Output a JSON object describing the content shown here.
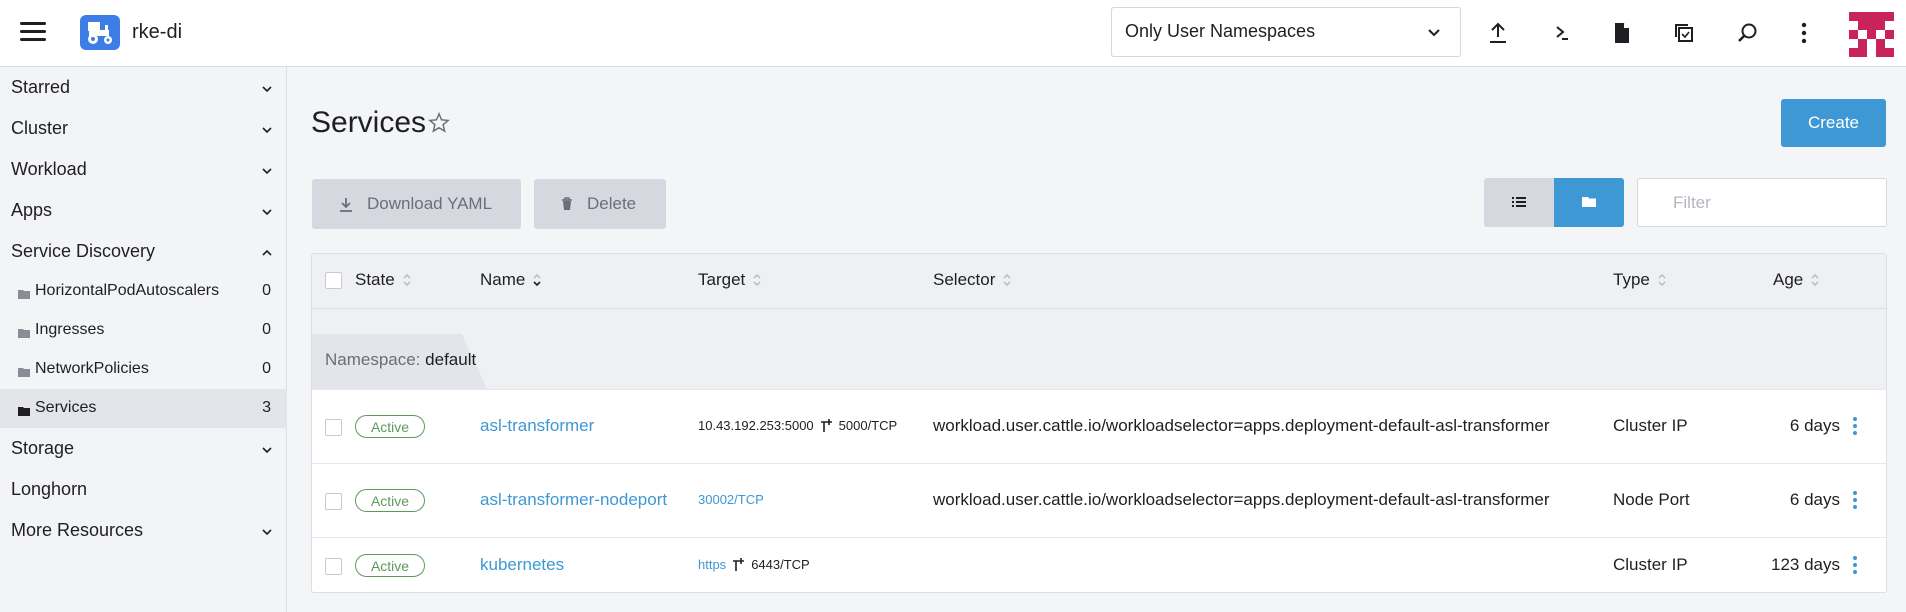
{
  "header": {
    "cluster_name": "rke-di",
    "namespace_filter": "Only User Namespaces",
    "actions": [
      "upload-icon",
      "terminal-icon",
      "file-icon",
      "copy-config-icon",
      "search-icon",
      "more-icon"
    ],
    "accent_color": "#3d98d3"
  },
  "sidebar": {
    "groups": [
      {
        "label": "Starred"
      },
      {
        "label": "Cluster"
      },
      {
        "label": "Workload"
      },
      {
        "label": "Apps"
      },
      {
        "label": "Service Discovery"
      },
      {
        "label": "Storage"
      },
      {
        "label": "Longhorn"
      },
      {
        "label": "More Resources"
      }
    ],
    "service_discovery_items": [
      {
        "label": "HorizontalPodAutoscalers",
        "count": "0"
      },
      {
        "label": "Ingresses",
        "count": "0"
      },
      {
        "label": "NetworkPolicies",
        "count": "0"
      },
      {
        "label": "Services",
        "count": "3"
      }
    ]
  },
  "main": {
    "title": "Services",
    "create_label": "Create",
    "download_yaml_label": "Download YAML",
    "delete_label": "Delete",
    "filter_placeholder": "Filter"
  },
  "table": {
    "columns": [
      "State",
      "Name",
      "Target",
      "Selector",
      "Type",
      "Age"
    ],
    "group_prefix": "Namespace:",
    "group_value": "default",
    "rows": [
      {
        "state": "Active",
        "name": "asl-transformer",
        "target_text": "10.43.192.253:5000",
        "target_port": "5000/TCP",
        "selector": "workload.user.cattle.io/workloadselector=apps.deployment-default-asl-transformer",
        "type": "Cluster IP",
        "age": "6 days"
      },
      {
        "state": "Active",
        "name": "asl-transformer-nodeport",
        "target_link": "30002/TCP",
        "selector": "workload.user.cattle.io/workloadselector=apps.deployment-default-asl-transformer",
        "type": "Node Port",
        "age": "6 days"
      },
      {
        "state": "Active",
        "name": "kubernetes",
        "target_link": "https",
        "target_port": "6443/TCP",
        "selector": "",
        "type": "Cluster IP",
        "age": "123 days"
      }
    ]
  }
}
